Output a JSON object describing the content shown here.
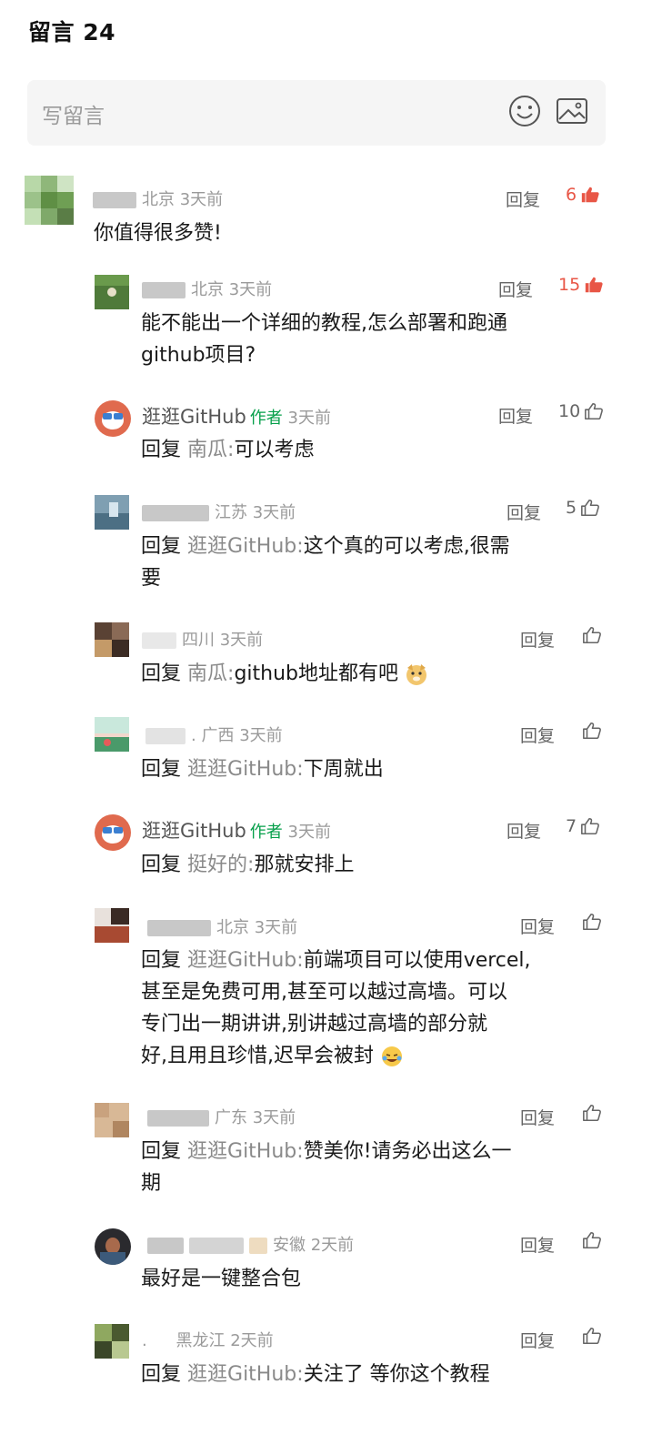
{
  "header": {
    "title": "留言 24"
  },
  "compose": {
    "placeholder": "写留言",
    "emoji_icon": "smiley-icon",
    "image_icon": "image-icon"
  },
  "colors": {
    "like_active": "#e85646",
    "author_tag": "#07a04b",
    "meta": "#9a9a9a"
  },
  "reply_label": "回复",
  "comments": [
    {
      "location": "北京",
      "time": "3天前",
      "likes": "6",
      "liked": true,
      "text": "你值得很多赞!"
    },
    {
      "location": "北京",
      "time": "3天前",
      "likes": "15",
      "liked": true,
      "text_line1": "能不能出一个详细的教程,怎么部署和跑通",
      "text_line2": "github项目?"
    },
    {
      "name": "逛逛GitHub",
      "tag": "作者",
      "time": "3天前",
      "likes": "10",
      "reply_to": "南瓜",
      "text": "可以考虑"
    },
    {
      "location": "江苏",
      "time": "3天前",
      "likes": "5",
      "reply_to": "逛逛GitHub",
      "text_line1": "这个真的可以考虑,很需",
      "text_line2": "要"
    },
    {
      "location": "四川",
      "time": "3天前",
      "reply_to": "南瓜",
      "text": "github地址都有吧"
    },
    {
      "location": "广西",
      "time": "3天前",
      "reply_to": "逛逛GitHub",
      "text": "下周就出"
    },
    {
      "name": "逛逛GitHub",
      "tag": "作者",
      "time": "3天前",
      "likes": "7",
      "reply_to": "挺好的",
      "text": "那就安排上"
    },
    {
      "location": "北京",
      "time": "3天前",
      "reply_to": "逛逛GitHub",
      "text_line1": "前端项目可以使用vercel,",
      "text_line2": "甚至是免费可用,甚至可以越过高墙。可以",
      "text_line3": "专门出一期讲讲,别讲越过高墙的部分就",
      "text_line4": "好,且用且珍惜,迟早会被封"
    },
    {
      "location": "广东",
      "time": "3天前",
      "reply_to": "逛逛GitHub",
      "text_line1": "赞美你!请务必出这么一",
      "text_line2": "期"
    },
    {
      "location": "安徽",
      "time": "2天前",
      "text": "最好是一键整合包"
    },
    {
      "location": "黑龙江",
      "time": "2天前",
      "reply_to": "逛逛GitHub",
      "text": "关注了 等你这个教程"
    }
  ]
}
